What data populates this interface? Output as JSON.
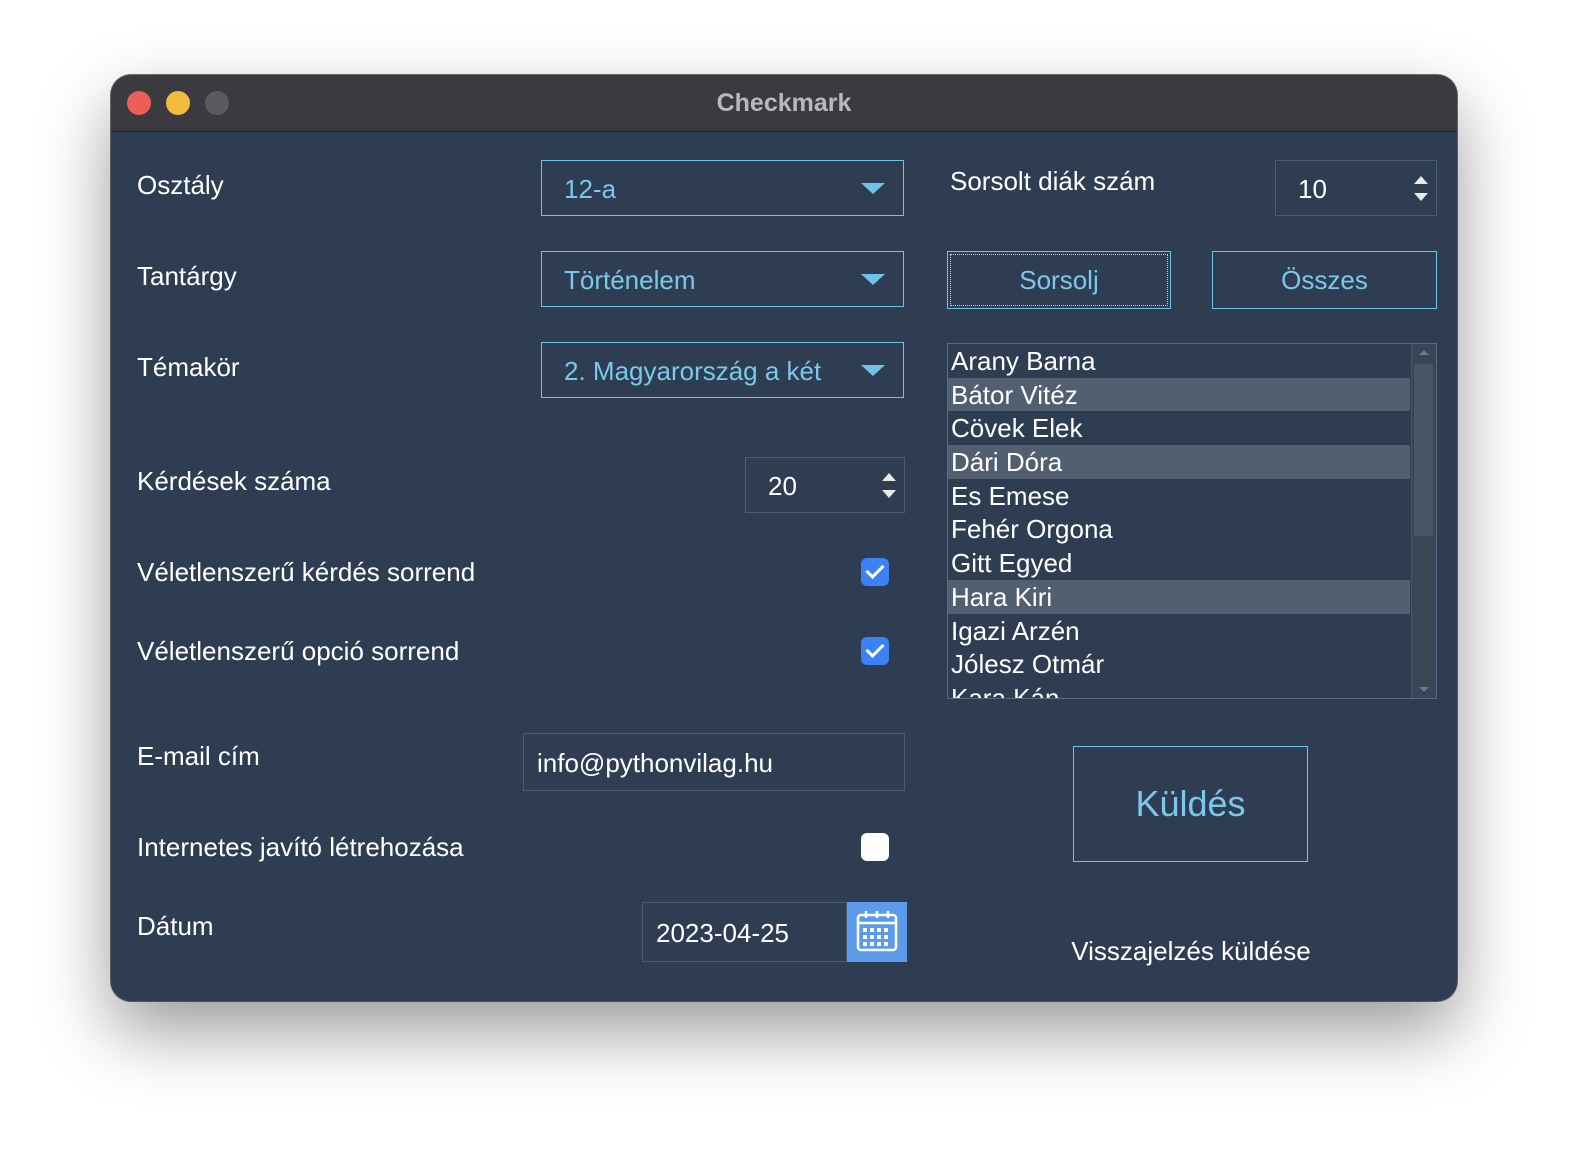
{
  "window": {
    "title": "Checkmark"
  },
  "form": {
    "class_label": "Osztály",
    "class_value": "12-a",
    "subject_label": "Tantárgy",
    "subject_value": "Történelem",
    "topic_label": "Témakör",
    "topic_value": "2. Magyarország a két",
    "question_count_label": "Kérdések száma",
    "question_count_value": "20",
    "random_question_label": "Véletlenszerű kérdés sorrend",
    "random_question_checked": true,
    "random_option_label": "Véletlenszerű opció sorrend",
    "random_option_checked": true,
    "email_label": "E-mail cím",
    "email_value": "info@pythonvilag.hu",
    "online_key_label": "Internetes javító létrehozása",
    "online_key_checked": false,
    "date_label": "Dátum",
    "date_value": "2023-04-25"
  },
  "draw": {
    "count_label": "Sorsolt diák szám",
    "count_value": "10",
    "draw_button": "Sorsolj",
    "all_button": "Összes"
  },
  "students": [
    {
      "name": "Arany Barna",
      "selected": false
    },
    {
      "name": "Bátor Vitéz",
      "selected": true
    },
    {
      "name": "Cövek Elek",
      "selected": false
    },
    {
      "name": "Dári Dóra",
      "selected": true
    },
    {
      "name": "Es Emese",
      "selected": false
    },
    {
      "name": "Fehér Orgona",
      "selected": false
    },
    {
      "name": "Gitt Egyed",
      "selected": false
    },
    {
      "name": "Hara Kiri",
      "selected": true
    },
    {
      "name": "Igazi Arzén",
      "selected": false
    },
    {
      "name": "Jólesz Otmár",
      "selected": false
    },
    {
      "name": "Kara Kán",
      "selected": false
    }
  ],
  "actions": {
    "send_button": "Küldés",
    "feedback_label": "Visszajelzés küldése"
  },
  "colors": {
    "window_bg": "#2e3d52",
    "titlebar_bg": "#3b3a3f",
    "accent": "#6ec3e8",
    "checkbox_on": "#3b82f6",
    "list_selected": "#525f70",
    "calendar_button": "#5c9bea"
  },
  "icons": {
    "dropdown": "chevron-down-icon",
    "calendar": "calendar-icon",
    "checkbox": "checkmark-icon"
  }
}
